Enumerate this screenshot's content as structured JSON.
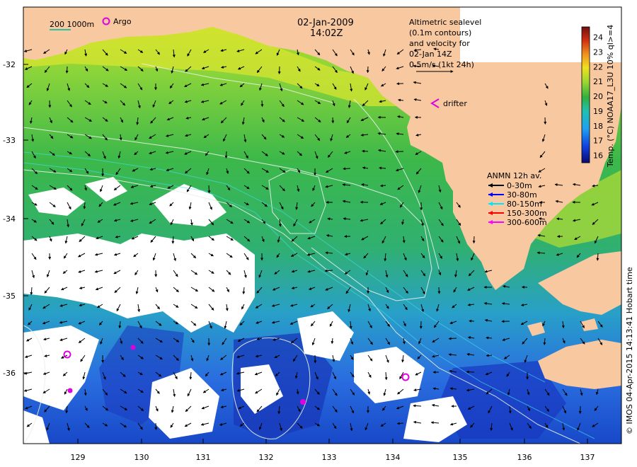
{
  "header": {
    "date": "02-Jan-2009",
    "time": "14:02Z",
    "scale_bar_label": "200  1000m",
    "argo_label": "Argo",
    "drifter_label": "drifter"
  },
  "altimetry_note": {
    "lines": [
      "Altimetric sealevel",
      "(0.1m contours)",
      "and velocity for",
      "02-Jan 14Z",
      "0.5m/s (1kt 24h)"
    ]
  },
  "anmn_legend": {
    "title": "ANMN 12h av.",
    "items": [
      {
        "label": "0-30m",
        "color": "#000000"
      },
      {
        "label": "30-80m",
        "color": "#0000ff"
      },
      {
        "label": "80-150m",
        "color": "#00e5ff"
      },
      {
        "label": "150-300m",
        "color": "#ff0000"
      },
      {
        "label": "300-600m",
        "color": "#ff00ff"
      }
    ]
  },
  "colorbar": {
    "label": "Temp. (°C) NOAA17_L3U 10% ql>=4",
    "ticks": [
      "16",
      "17",
      "18",
      "19",
      "20",
      "21",
      "22",
      "23",
      "24"
    ],
    "min": 15.5,
    "max": 24.7
  },
  "axes": {
    "lat_ticks": [
      "-32",
      "-33",
      "-34",
      "-35",
      "-36"
    ],
    "lon_ticks": [
      "129",
      "130",
      "131",
      "132",
      "133",
      "134",
      "135",
      "136",
      "137"
    ]
  },
  "copyright": "© IMOS 04-Apr-2015 14:13:41 Hobart time",
  "colors": {
    "land": "#f8c8a0",
    "cloud": "#ffffff",
    "arrow": "#000000",
    "marker": "#e000e0"
  }
}
